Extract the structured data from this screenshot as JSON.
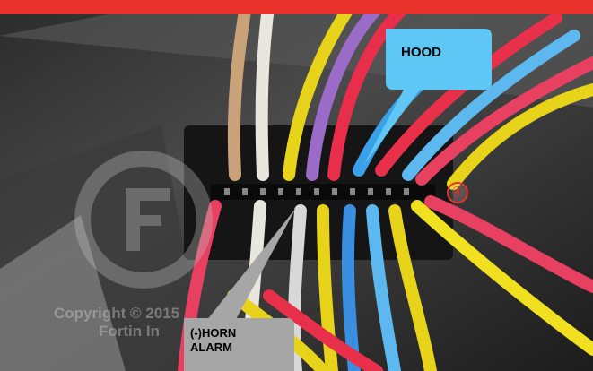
{
  "top_bar_color": "#e8312a",
  "callouts": {
    "hood_label": "HOOD",
    "horn_label": "(-)HORN\nALARM",
    "hood_color": "#5fc7f5",
    "horn_color": "#a6a6a6"
  },
  "marker": {
    "number": "④",
    "color": "#e8312a"
  },
  "watermark": {
    "line1": "Copyright © 2015",
    "line2": "Fortin In"
  }
}
